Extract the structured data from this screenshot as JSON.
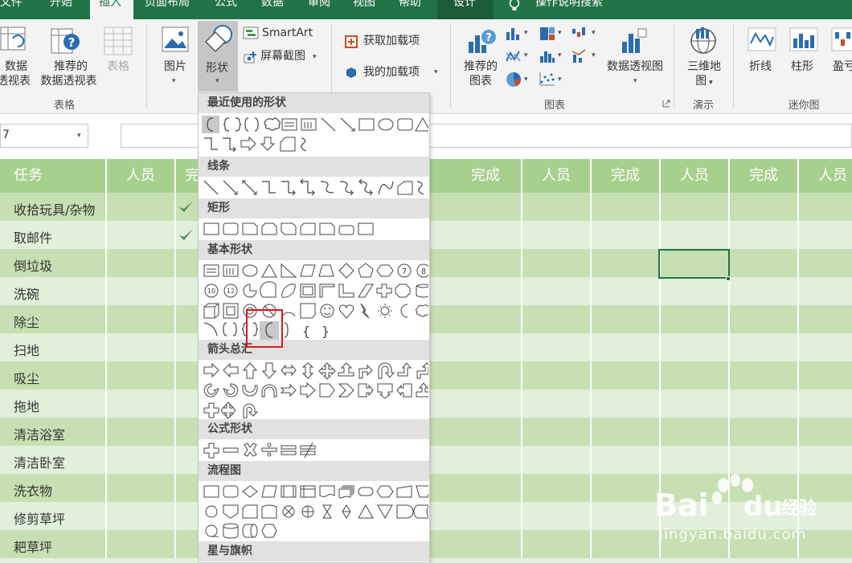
{
  "tabs": [
    {
      "label": "文件",
      "active": false
    },
    {
      "label": "开始",
      "active": false
    },
    {
      "label": "插入",
      "active": true
    },
    {
      "label": "页面布局",
      "active": false
    },
    {
      "label": "公式",
      "active": false
    },
    {
      "label": "数据",
      "active": false
    },
    {
      "label": "审阅",
      "active": false
    },
    {
      "label": "视图",
      "active": false
    },
    {
      "label": "帮助",
      "active": false
    },
    {
      "label": "设计",
      "active": false
    }
  ],
  "tell_me": "操作说明搜索",
  "ribbon": {
    "pivot_line1": "数据",
    "pivot_line2": "透视表",
    "rec_pivot_line1": "推荐的",
    "rec_pivot_line2": "数据透视表",
    "table": "表格",
    "group_tables": "表格",
    "pictures": "图片",
    "shapes": "形状",
    "smartart": "SmartArt",
    "screenshot": "屏幕截图",
    "get_addins": "获取加载项",
    "my_addins": "我的加载项",
    "rec_charts_line1": "推荐的",
    "rec_charts_line2": "图表",
    "pivot_chart": "数据透视图",
    "group_charts": "图表",
    "map3d_line1": "三维地",
    "map3d_line2": "图",
    "group_tours": "演示",
    "spark_line": "折线",
    "spark_column": "柱形",
    "spark_winloss": "盈亏",
    "group_sparklines": "迷你图"
  },
  "formula_bar": {
    "name_box": "7"
  },
  "sheet": {
    "headers": [
      "任务",
      "人员",
      "完",
      "完成",
      "人员",
      "完成",
      "人员",
      "完成",
      "人员"
    ],
    "tasks": [
      "收拾玩具/杂物",
      "取邮件",
      "倒垃圾",
      "洗碗",
      "除尘",
      "扫地",
      "吸尘",
      "拖地",
      "清洁浴室",
      "清洁卧室",
      "洗衣物",
      "修剪草坪",
      "耙草坪"
    ],
    "checked_rows": [
      0,
      1
    ]
  },
  "shapes_menu": {
    "categories": [
      "最近使用的形状",
      "线条",
      "矩形",
      "基本形状",
      "箭头总汇",
      "公式形状",
      "流程图",
      "星与旗帜"
    ]
  },
  "colors": {
    "excel_green": "#217346",
    "header_green": "#a8d08d",
    "row_dark": "#c6e0b4",
    "row_light": "#e2efda",
    "highlight_red": "#d9191c"
  },
  "watermark": {
    "brand": "Baidu经验",
    "url": "jingyan.baidu.com"
  }
}
